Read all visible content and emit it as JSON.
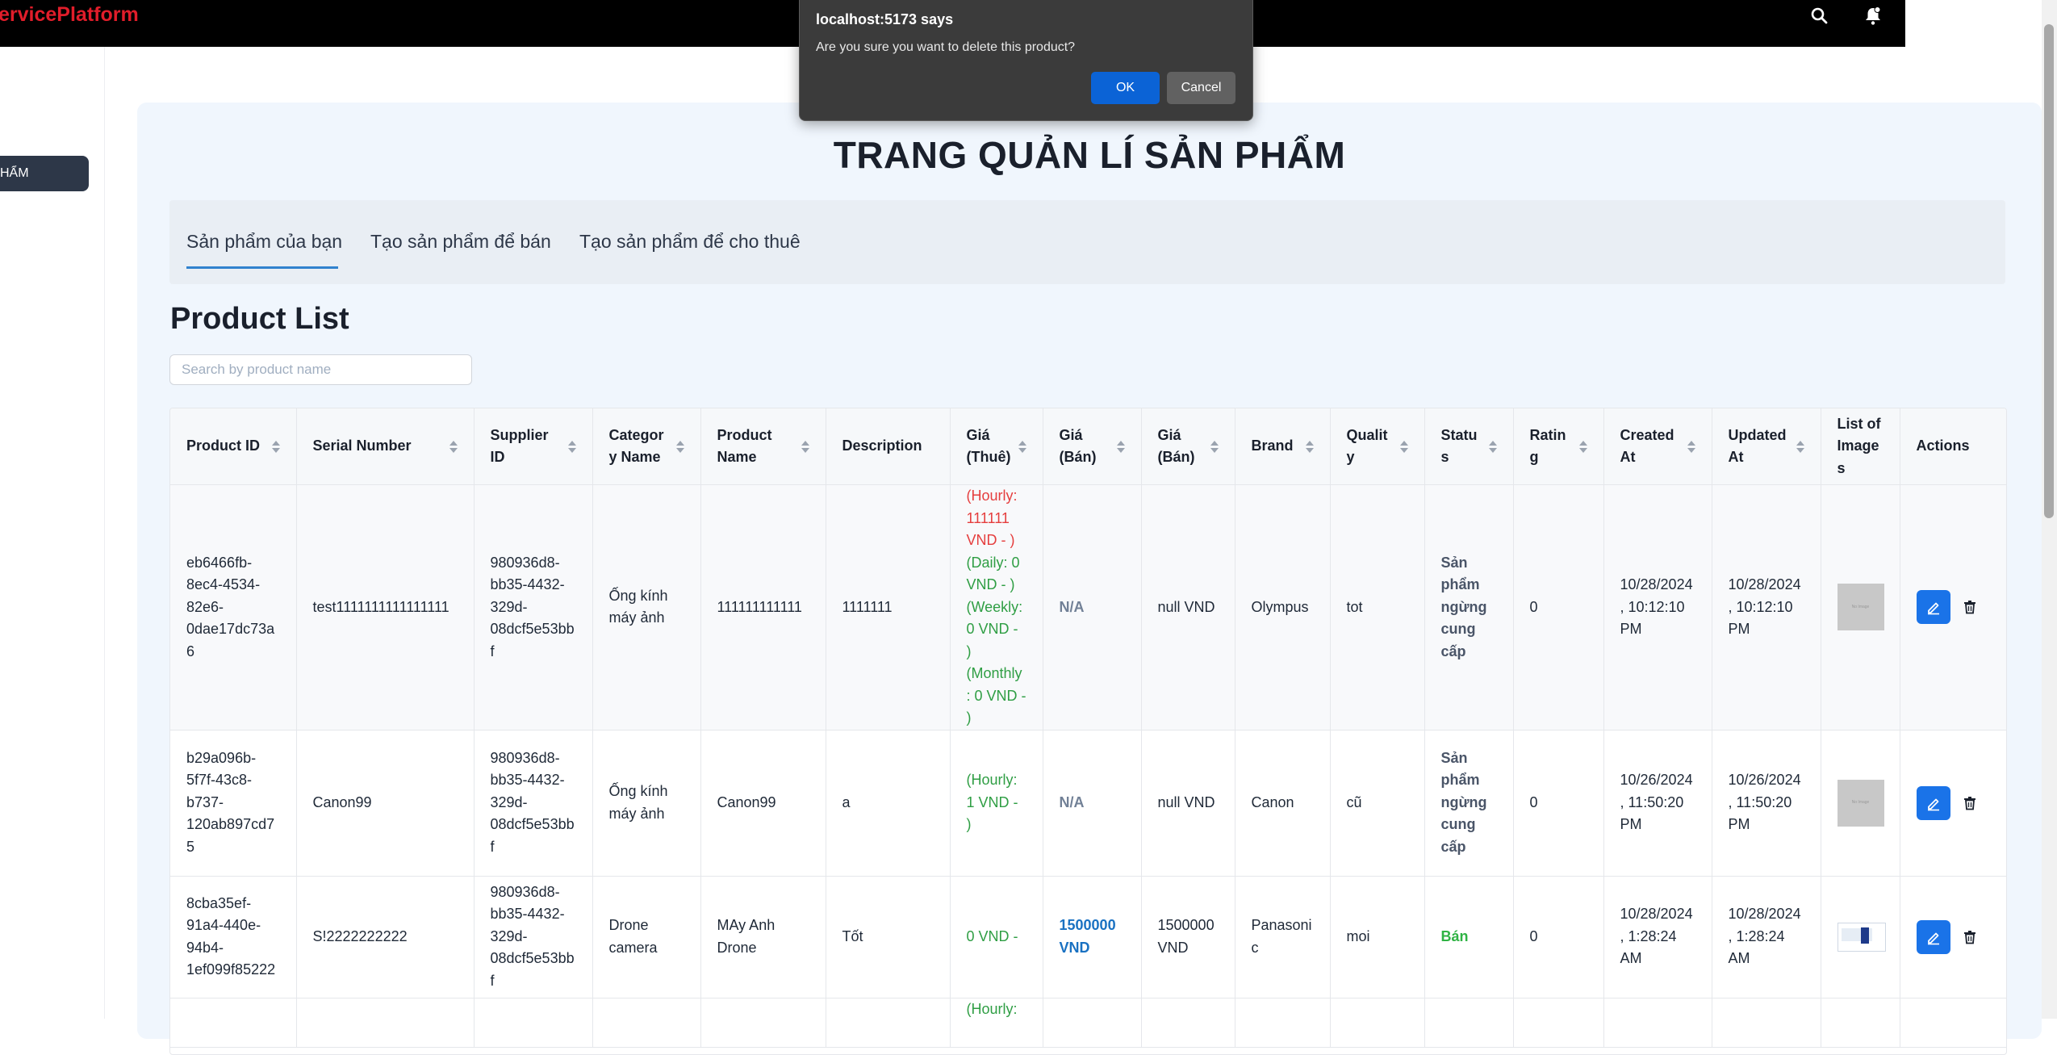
{
  "app": {
    "brand": "ervicePlatform"
  },
  "header": {
    "icons": [
      "search-icon",
      "bell-icon"
    ]
  },
  "sidebar": {
    "active_item": "HẨM"
  },
  "page": {
    "title": "TRANG QUẢN LÍ SẢN PHẨM",
    "tabs": [
      {
        "label": "Sản phẩm của bạn",
        "active": true
      },
      {
        "label": "Tạo sản phẩm để bán"
      },
      {
        "label": "Tạo sản phẩm để cho thuê"
      }
    ],
    "list_title": "Product List",
    "search_placeholder": "Search by product name"
  },
  "table": {
    "columns": [
      {
        "label": "Product ID",
        "sortable": true
      },
      {
        "label": "Serial Number",
        "sortable": true
      },
      {
        "label": "Supplier ID",
        "sortable": true
      },
      {
        "label": "Category Name",
        "sortable": true
      },
      {
        "label": "Product Name",
        "sortable": true
      },
      {
        "label": "Description",
        "sortable": false
      },
      {
        "label": "Giá (Thuê)",
        "sortable": true
      },
      {
        "label": "Giá (Bán)",
        "sortable": true
      },
      {
        "label": "Giá (Bán)",
        "sortable": true
      },
      {
        "label": "Brand",
        "sortable": true
      },
      {
        "label": "Quality",
        "sortable": true
      },
      {
        "label": "Status",
        "sortable": true
      },
      {
        "label": "Rating",
        "sortable": true
      },
      {
        "label": "Created At",
        "sortable": true
      },
      {
        "label": "Updated At",
        "sortable": true
      },
      {
        "label": "List of Images",
        "sortable": false
      },
      {
        "label": "Actions",
        "sortable": false
      }
    ],
    "rows": [
      {
        "product_id": "eb6466fb-8ec4-4534-82e6-0dae17dc73a6",
        "serial": "test1111111111111111",
        "supplier_id": "980936d8-bb35-4432-329d-08dcf5e53bbf",
        "category": "Ống kính máy ảnh",
        "name": "111111111111",
        "description": "1111111",
        "rent": [
          {
            "text": "(Hourly: 111111 VND - )",
            "tone": "red"
          },
          {
            "text": "(Daily: 0 VND - )",
            "tone": "green"
          },
          {
            "text": "(Weekly: 0 VND - )",
            "tone": "green"
          },
          {
            "text": "(Monthly: 0 VND - )",
            "tone": "green"
          }
        ],
        "sale_price": "N/A",
        "sale_price_tone": "na",
        "price2": "null VND",
        "brand": "Olympus",
        "quality": "tot",
        "status": "Sản phẩm ngừng cung cấp",
        "status_tone": "stop",
        "rating": "0",
        "created": "10/28/2024, 10:12:10 PM",
        "updated": "10/28/2024, 10:12:10 PM",
        "image_kind": "placeholder",
        "image_label": "No Image"
      },
      {
        "product_id": "b29a096b-5f7f-43c8-b737-120ab897cd75",
        "serial": "Canon99",
        "supplier_id": "980936d8-bb35-4432-329d-08dcf5e53bbf",
        "category": "Ống kính máy ảnh",
        "name": "Canon99",
        "description": "a",
        "rent": [
          {
            "text": "(Hourly: 1 VND - )",
            "tone": "green"
          }
        ],
        "sale_price": "N/A",
        "sale_price_tone": "na",
        "price2": "null VND",
        "brand": "Canon",
        "quality": "cũ",
        "status": "Sản phẩm ngừng cung cấp",
        "status_tone": "stop",
        "rating": "0",
        "created": "10/26/2024, 11:50:20 PM",
        "updated": "10/26/2024, 11:50:20 PM",
        "image_kind": "placeholder",
        "image_label": "No Image"
      },
      {
        "product_id": "8cba35ef-91a4-440e-94b4-1ef099f85222",
        "serial": "S!2222222222",
        "supplier_id": "980936d8-bb35-4432-329d-08dcf5e53bbf",
        "category": "Drone camera",
        "name": "MAy Anh Drone",
        "description": "Tốt",
        "rent": [
          {
            "text": "0 VND -",
            "tone": "green"
          }
        ],
        "sale_price": "1500000 VND",
        "sale_price_tone": "blue",
        "price2": "1500000 VND",
        "brand": "Panasonic",
        "quality": "moi",
        "status": "Bán",
        "status_tone": "sale",
        "rating": "0",
        "created": "10/28/2024, 1:28:24 AM",
        "updated": "10/28/2024, 1:28:24 AM",
        "image_kind": "photo",
        "image_label": ""
      },
      {
        "rent": [
          {
            "text": "(Hourly:",
            "tone": "green"
          }
        ]
      }
    ]
  },
  "dialog": {
    "title": "localhost:5173 says",
    "message": "Are you sure you want to delete this product?",
    "ok_label": "OK",
    "cancel_label": "Cancel"
  },
  "colors": {
    "brand": "#e11d2a",
    "primary": "#1a73e8",
    "rent_red": "#e53e3e",
    "rent_green": "#2f9e44",
    "sale_green": "#2fb344",
    "price_blue": "#1971c2",
    "dialog_ok": "#0b63d6"
  }
}
